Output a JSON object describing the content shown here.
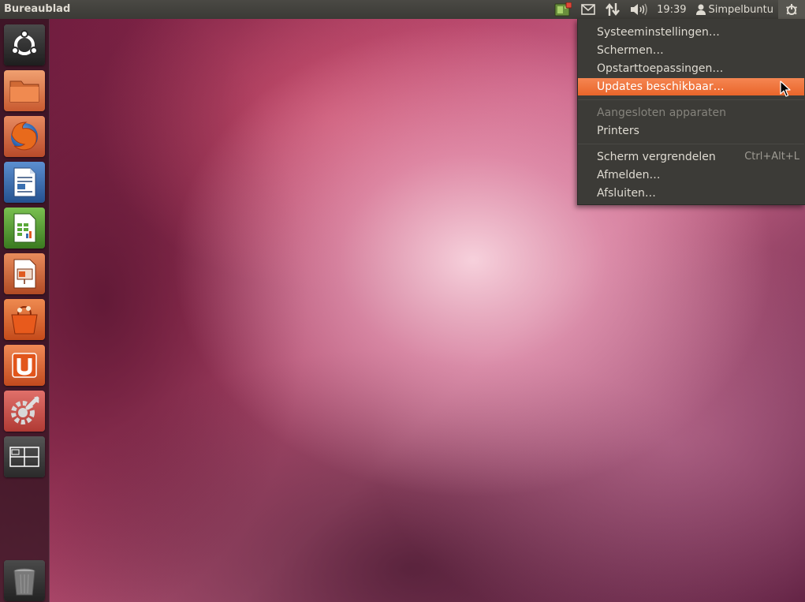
{
  "panel": {
    "title": "Bureaublad",
    "clock": "19:39",
    "user": "Simpelbuntu"
  },
  "launcher": {
    "items": [
      {
        "name": "ubuntu-logo-icon"
      },
      {
        "name": "home-folder-icon"
      },
      {
        "name": "firefox-icon"
      },
      {
        "name": "libreoffice-writer-icon"
      },
      {
        "name": "libreoffice-calc-icon"
      },
      {
        "name": "libreoffice-impress-icon"
      },
      {
        "name": "software-center-icon"
      },
      {
        "name": "ubuntu-one-icon"
      },
      {
        "name": "system-settings-icon"
      },
      {
        "name": "workspace-switcher-icon"
      },
      {
        "name": "trash-icon"
      }
    ]
  },
  "menu": {
    "items": [
      {
        "label": "Systeeminstellingen…"
      },
      {
        "label": "Schermen…"
      },
      {
        "label": "Opstarttoepassingen…"
      },
      {
        "label": "Updates beschikbaar…",
        "state": "highlighted"
      },
      {
        "label": "Aangesloten apparaten",
        "state": "disabled"
      },
      {
        "label": "Printers"
      },
      {
        "label": "Scherm vergrendelen",
        "accel": "Ctrl+Alt+L"
      },
      {
        "label": "Afmelden…"
      },
      {
        "label": "Afsluiten…"
      }
    ]
  },
  "colors": {
    "panel": "#3c3b37",
    "accent": "#e9652a",
    "menu_text": "#dfdbd2"
  }
}
